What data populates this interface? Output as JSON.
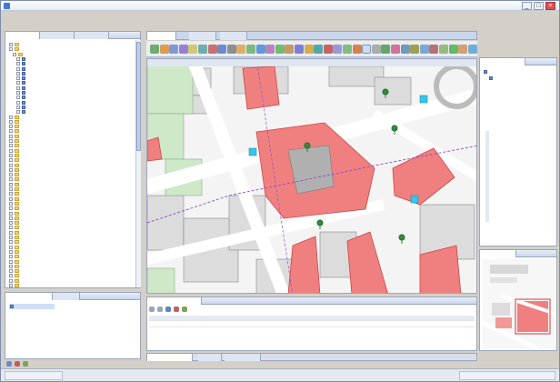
{
  "app": {
    "title": ""
  },
  "menu": {
    "items": [
      "",
      "",
      "",
      "",
      "",
      "",
      "",
      "",
      "",
      "",
      "",
      "",
      ""
    ]
  },
  "left_panel": {
    "tabs": [
      "",
      "",
      ""
    ],
    "tree": [
      "",
      "",
      "",
      "",
      "",
      "",
      "",
      "",
      "",
      "",
      "",
      "",
      "",
      "",
      "",
      "",
      "",
      "",
      "",
      "",
      "",
      "",
      "",
      "",
      "",
      "",
      "",
      "",
      "",
      "",
      "",
      "",
      "",
      "",
      "",
      "",
      "",
      "",
      "",
      "",
      "",
      "",
      "",
      "",
      "",
      "",
      "",
      "",
      "",
      "",
      ""
    ]
  },
  "left_bottom_panel": {
    "tabs": [
      "",
      ""
    ],
    "selected_item": ""
  },
  "map_window": {
    "tabs": [
      "",
      "",
      ""
    ]
  },
  "map_view": {
    "title": ""
  },
  "properties_panel": {
    "title": "",
    "column_headers": [
      "",
      "",
      ""
    ],
    "row": [
      "",
      "",
      ""
    ]
  },
  "right_top_panel": {
    "title": "",
    "items": [
      "",
      ""
    ]
  },
  "right_bottom_panel": {
    "title": ""
  },
  "bottom_tabs": [
    "",
    "",
    ""
  ],
  "statusbar": {
    "cells": [
      "",
      ""
    ]
  },
  "colors": {
    "building": "#f08080",
    "road": "#ffffff",
    "block": "#dcdcdc",
    "green": "#cfe8c8",
    "boundary": "#8c4cc7",
    "accent": "#3f7cd1"
  }
}
